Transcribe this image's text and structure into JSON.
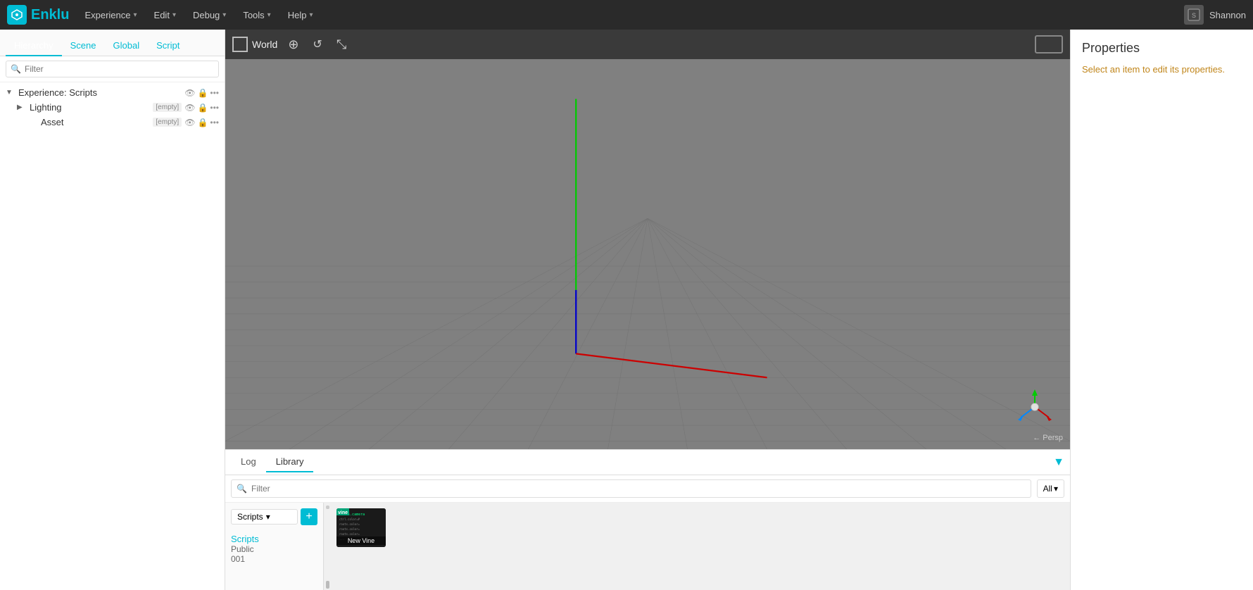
{
  "app": {
    "logo_text": "E",
    "app_name": "Enklu"
  },
  "menubar": {
    "items": [
      {
        "label": "Experience",
        "has_arrow": true
      },
      {
        "label": "Edit",
        "has_arrow": true
      },
      {
        "label": "Debug",
        "has_arrow": true
      },
      {
        "label": "Tools",
        "has_arrow": true
      },
      {
        "label": "Help",
        "has_arrow": true
      }
    ],
    "user_name": "Shannon"
  },
  "left_panel": {
    "tabs": [
      {
        "label": "Hierarchy",
        "active": true
      },
      {
        "label": "Scene",
        "active": false
      },
      {
        "label": "Global",
        "active": false
      },
      {
        "label": "Script",
        "active": false
      }
    ],
    "filter_placeholder": "Filter",
    "tree": [
      {
        "label": "Experience: Scripts",
        "level": 0,
        "has_arrow": true,
        "arrow_dir": "down",
        "badge": "",
        "icons": [
          "eye",
          "lock",
          "ellipsis"
        ]
      },
      {
        "label": "Lighting",
        "level": 1,
        "has_arrow": true,
        "arrow_dir": "right",
        "badge": "[empty]",
        "icons": [
          "eye",
          "lock",
          "ellipsis"
        ]
      },
      {
        "label": "Asset",
        "level": 2,
        "has_arrow": false,
        "badge": "[empty]",
        "icons": [
          "eye",
          "lock",
          "ellipsis"
        ]
      }
    ]
  },
  "viewport": {
    "world_label": "World",
    "persp_label": "← Persp"
  },
  "bottom_panel": {
    "tabs": [
      {
        "label": "Log",
        "active": false
      },
      {
        "label": "Library",
        "active": true
      }
    ],
    "filter_placeholder": "Filter",
    "all_label": "All",
    "scripts_dropdown_label": "Scripts",
    "scripts_add_label": "+",
    "scripts_section": {
      "title": "Scripts",
      "subtitle": "Public",
      "number": "001"
    },
    "assets": [
      {
        "name": "New Vine",
        "has_thumb": true
      }
    ]
  },
  "right_panel": {
    "title": "Properties",
    "hint": "Select an item to edit its properties."
  }
}
